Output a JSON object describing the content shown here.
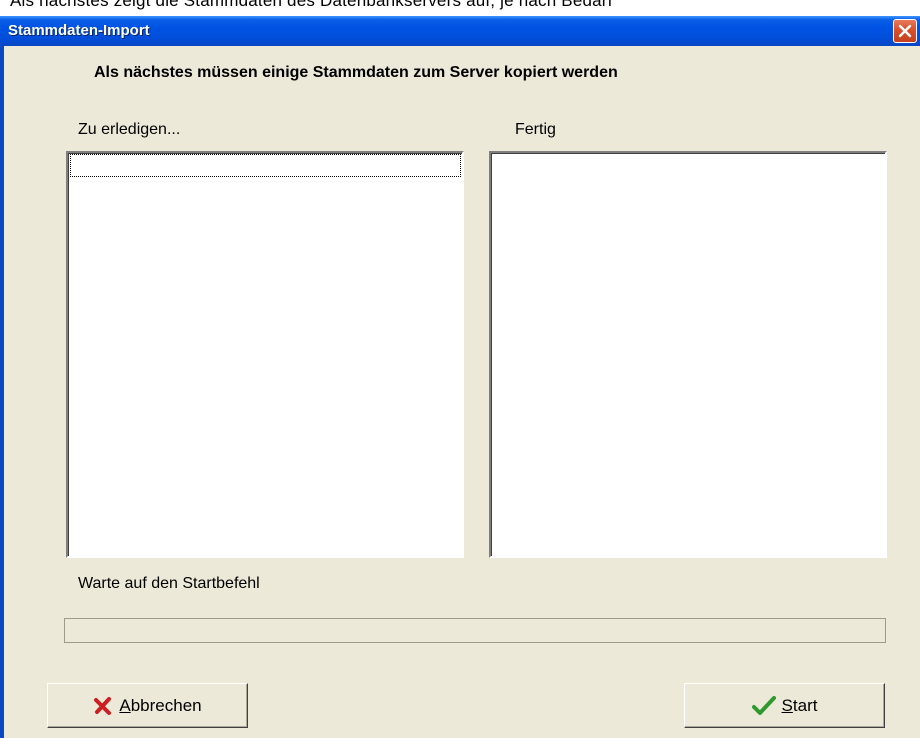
{
  "background": {
    "partial_text": "Als nächstes zeigt die Stammdaten des Datenbankservers auf, je nach Bedarf"
  },
  "window": {
    "title": "Stammdaten-Import",
    "close_icon": "close-x-icon"
  },
  "dialog": {
    "instruction": "Als nächstes müssen einige Stammdaten zum Server kopiert werden",
    "todo_label": "Zu erledigen...",
    "done_label": "Fertig",
    "todo_items": [],
    "done_items": [],
    "status": "Warte auf den Startbefehl",
    "progress": 0
  },
  "buttons": {
    "cancel_access": "A",
    "cancel_rest": "bbrechen",
    "cancel_icon": "red-x-icon",
    "start_access": "S",
    "start_rest": "tart",
    "start_icon": "green-check-icon"
  },
  "colors": {
    "titlebar": "#0054e3",
    "close_button": "#d8502c",
    "dialog_bg": "#ece9d8",
    "cancel_icon": "#cc1f1f",
    "start_icon": "#2e9a2e"
  }
}
